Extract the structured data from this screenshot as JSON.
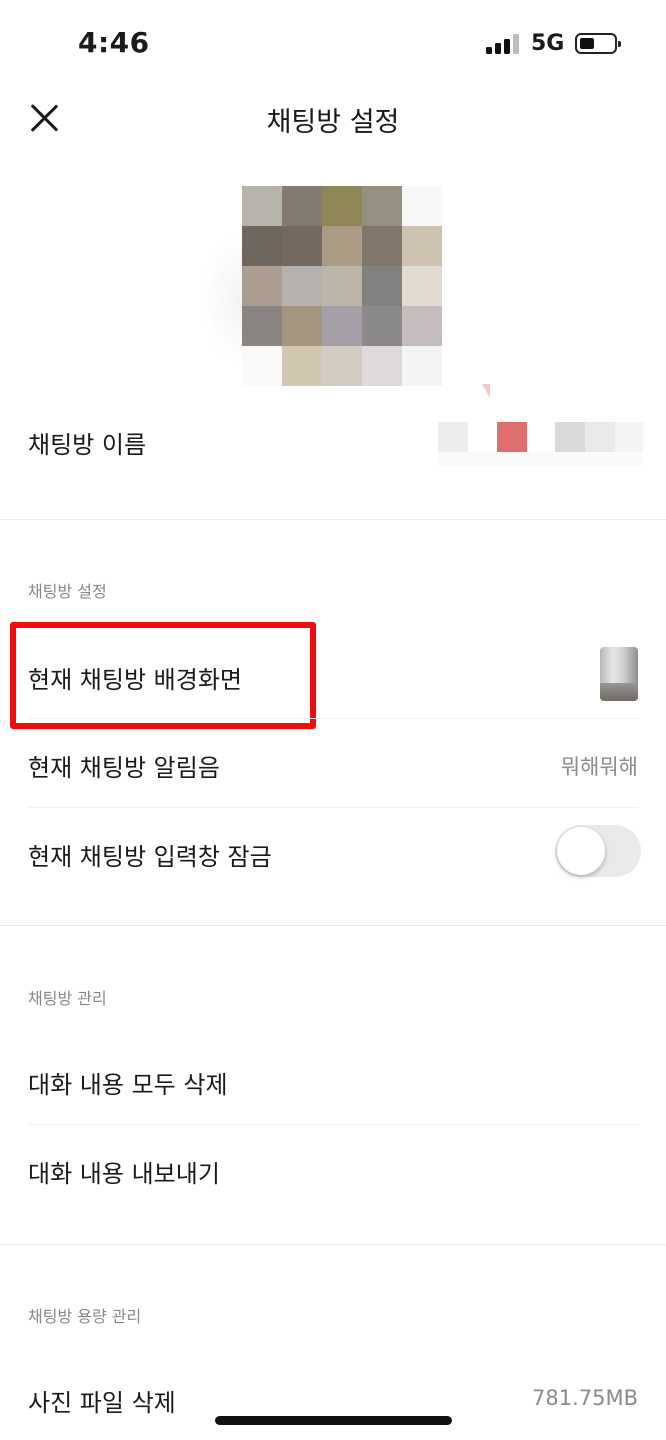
{
  "status_bar": {
    "time": "4:46",
    "network": "5G"
  },
  "header": {
    "title": "채팅방 설정"
  },
  "profile": {
    "pixel_colors": [
      "#b6b3aa",
      "#847b70",
      "#8f8656",
      "#969080",
      "#f8f8f8",
      "#6f675e",
      "#746a61",
      "#a99b84",
      "#817769",
      "#cdc1b0",
      "#ab9e90",
      "#b6b1ac",
      "#bcb5a8",
      "#838180",
      "#e1dbd2",
      "#8a8582",
      "#a49581",
      "#a59fa8",
      "#8b8989",
      "#c5bcbd",
      "#fbfaf9",
      "#d2c7b3",
      "#d2cbc2",
      "#dddad9",
      "#f4f4f4"
    ]
  },
  "chat_name": {
    "label": "채팅방 이름",
    "accent_color": "#dc6e6d"
  },
  "settings_section": {
    "header": "채팅방 설정",
    "background": {
      "label": "현재 채팅방 배경화면"
    },
    "notification": {
      "label": "현재 채팅방 알림음",
      "value": "뭐해뭐해"
    },
    "input_lock": {
      "label": "현재 채팅방 입력창 잠금",
      "enabled": false
    }
  },
  "manage_section": {
    "header": "채팅방 관리",
    "delete_all": {
      "label": "대화 내용 모두 삭제"
    },
    "export": {
      "label": "대화 내용 내보내기"
    }
  },
  "storage_section": {
    "header": "채팅방 용량 관리",
    "delete_photos": {
      "label": "사진 파일 삭제",
      "value": "781.75MB"
    }
  },
  "highlight_color": "#ee0d0d"
}
